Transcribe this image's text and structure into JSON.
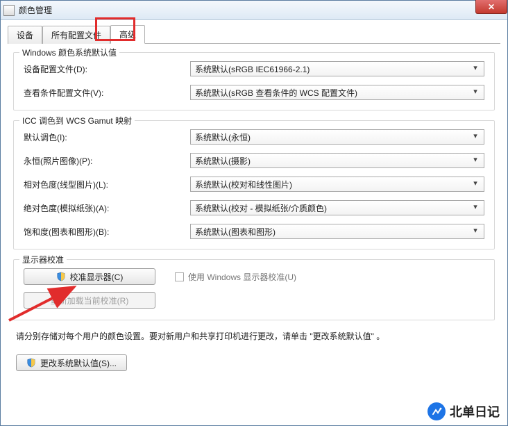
{
  "window": {
    "title": "颜色管理"
  },
  "tabs": {
    "devices": "设备",
    "profiles": "所有配置文件",
    "advanced": "高级"
  },
  "group1": {
    "legend": "Windows 颜色系统默认值",
    "device_profile_label": "设备配置文件(D):",
    "device_profile_value": "系统默认(sRGB IEC61966-2.1)",
    "viewing_label": "查看条件配置文件(V):",
    "viewing_value": "系统默认(sRGB 查看条件的 WCS 配置文件)"
  },
  "group2": {
    "legend": "ICC 调色到 WCS Gamut 映射",
    "default_intent_label": "默认调色(I):",
    "default_intent_value": "系统默认(永恒)",
    "perceptual_label": "永恒(照片图像)(P):",
    "perceptual_value": "系统默认(摄影)",
    "relative_label": "相对色度(线型图片)(L):",
    "relative_value": "系统默认(校对和线性图片)",
    "absolute_label": "绝对色度(模拟纸张)(A):",
    "absolute_value": "系统默认(校对 - 模拟纸张/介质颜色)",
    "saturation_label": "饱和度(图表和图形)(B):",
    "saturation_value": "系统默认(图表和图形)"
  },
  "group3": {
    "legend": "显示器校准",
    "calibrate_btn": "校准显示器(C)",
    "use_win_calib": "使用 Windows 显示器校准(U)",
    "reload_btn": "重新加载当前校准(R)"
  },
  "instruction": "请分别存储对每个用户的颜色设置。要对新用户和共享打印机进行更改，请单击 \"更改系统默认值\" 。",
  "change_defaults_btn": "更改系统默认值(S)...",
  "watermark": "北单日记"
}
